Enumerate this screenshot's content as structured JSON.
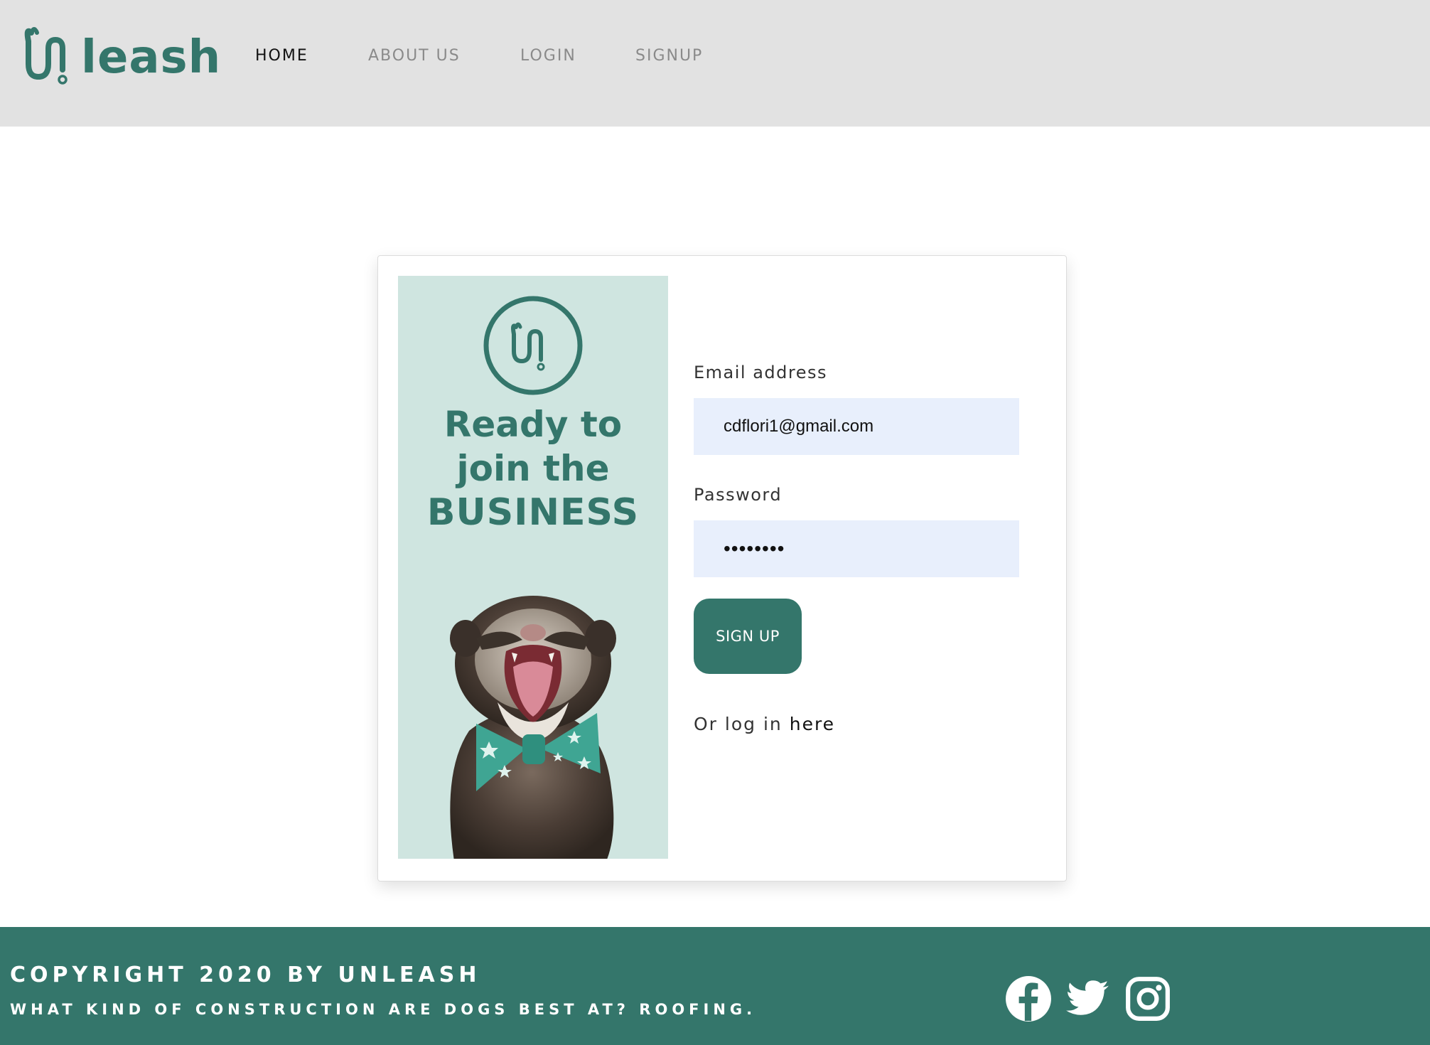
{
  "brand": {
    "name": "leash",
    "logo_icon": "leash-u-icon",
    "color": "#34766b"
  },
  "nav": [
    {
      "label": "HOME",
      "active": true
    },
    {
      "label": "ABOUT US",
      "active": false
    },
    {
      "label": "LOGIN",
      "active": false
    },
    {
      "label": "SIGNUP",
      "active": false
    }
  ],
  "promo": {
    "line1": "Ready to",
    "line2": "join the",
    "line3": "BUSINESS",
    "badge_icon": "leash-badge-icon",
    "image": "ferret-with-bowtie"
  },
  "form": {
    "email_label": "Email address",
    "email_value": "cdflori1@gmail.com",
    "password_label": "Password",
    "password_value": "••••••••",
    "submit_label": "SIGN UP",
    "login_prefix": "Or log in",
    "login_link": "here"
  },
  "footer": {
    "copyright": "COPYRIGHT 2020 BY UNLEASH",
    "tagline": "WHAT KIND OF CONSTRUCTION ARE DOGS BEST AT? ROOFING.",
    "social": [
      "facebook-icon",
      "twitter-icon",
      "instagram-icon"
    ]
  },
  "colors": {
    "nav_bg": "#e2e2e2",
    "brand": "#34766b",
    "promo_bg": "#cfe5e0",
    "input_bg": "#e8effc"
  }
}
